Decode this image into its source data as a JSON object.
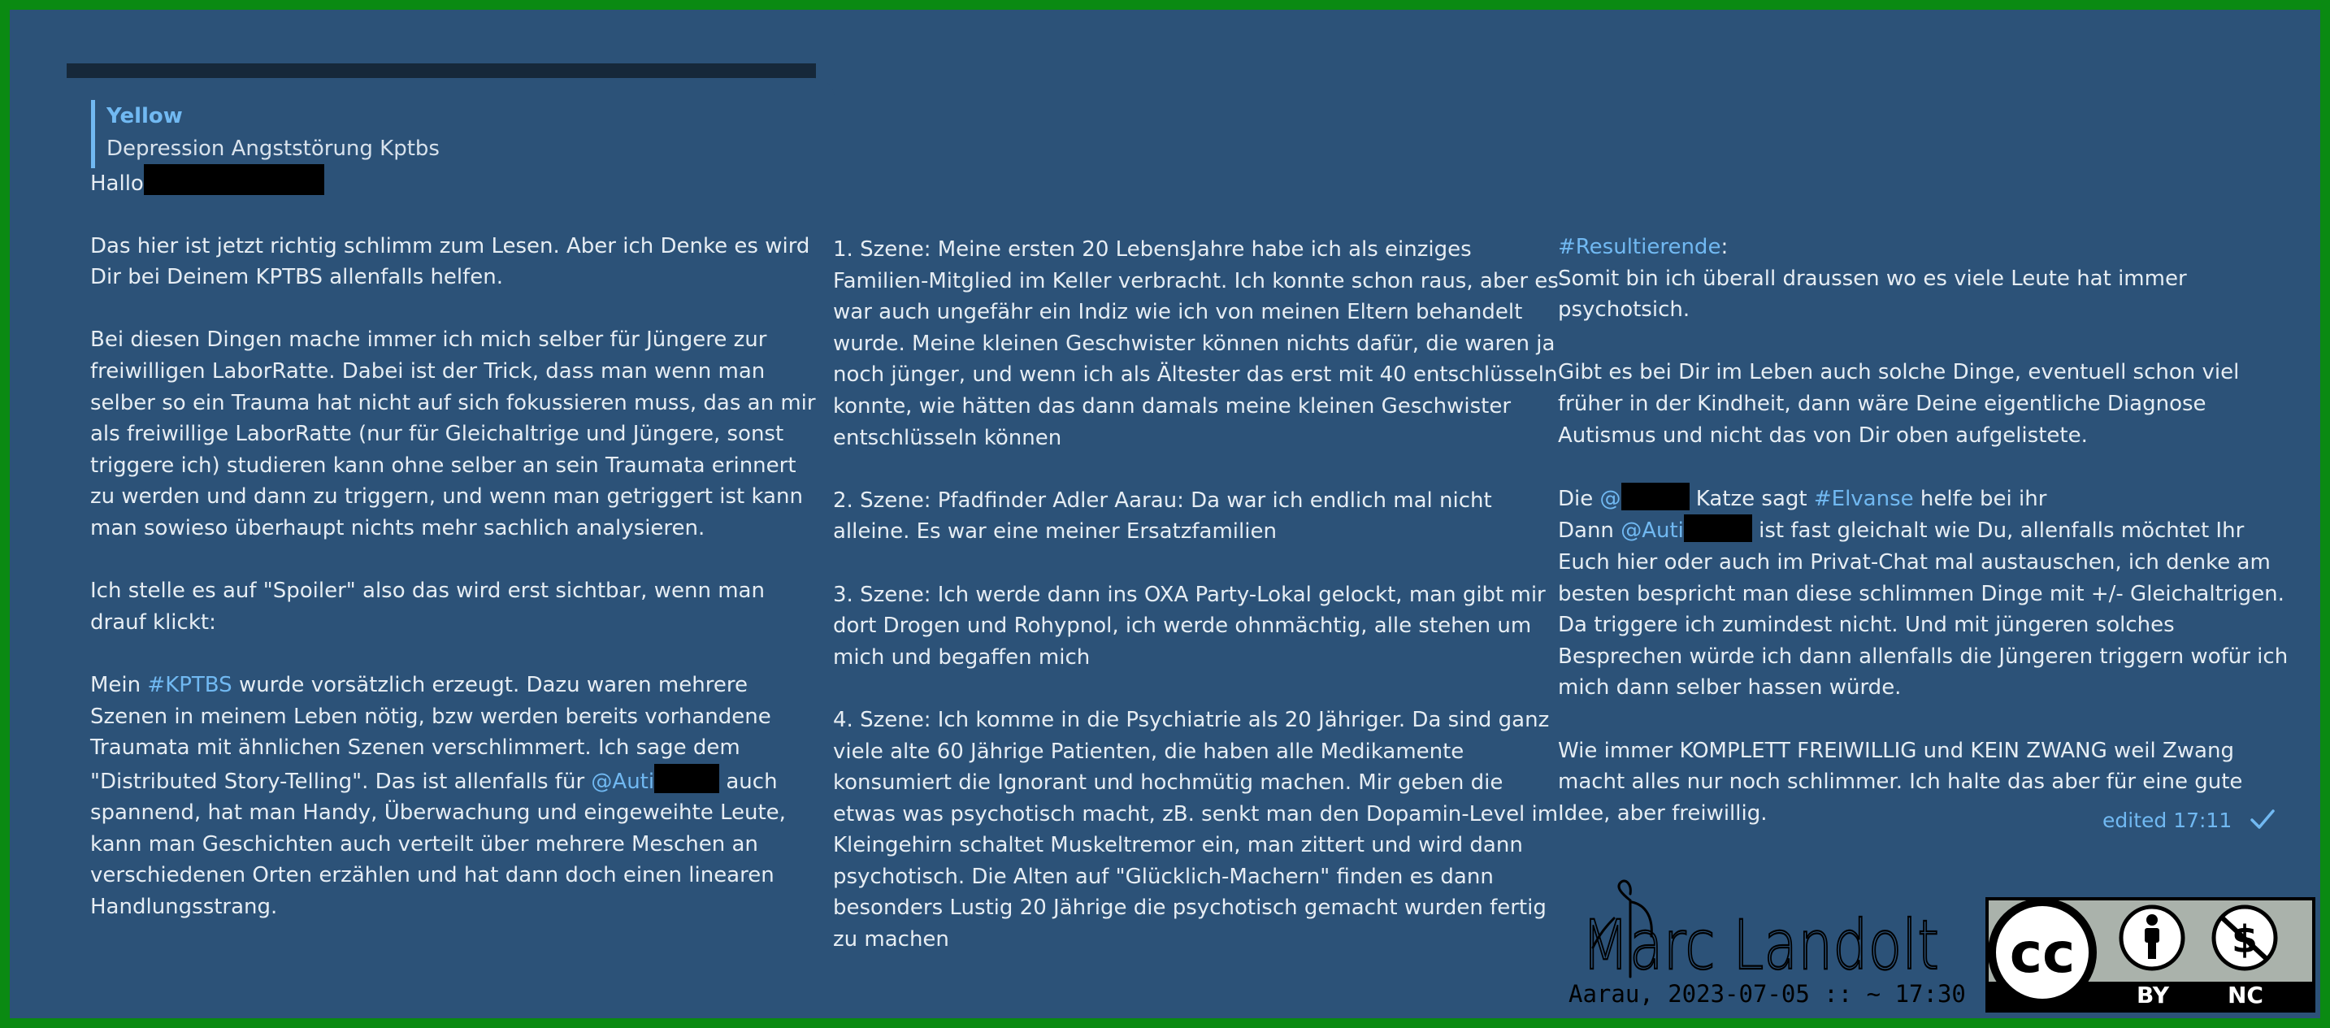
{
  "reply": {
    "name": "Yellow",
    "text": "Depression  Angststörung  Kptbs"
  },
  "message": {
    "greeting": "Hallo",
    "col1": {
      "p1": "Das hier ist jetzt richtig schlimm zum Lesen. Aber ich Denke es wird Dir bei Deinem KPTBS allenfalls helfen.",
      "p2": "Bei diesen Dingen mache immer ich mich selber für Jüngere zur freiwilligen LaborRatte. Dabei ist der Trick, dass man wenn man selber so ein Trauma hat nicht auf sich fokussieren muss, das an mir als freiwillige LaborRatte (nur für Gleichaltrige und Jüngere, sonst triggere ich) studieren kann ohne selber an sein Traumata erinnert zu werden und dann zu triggern, und wenn man getriggert ist kann man sowieso überhaupt nichts mehr sachlich analysieren.",
      "p3": "Ich stelle es auf \"Spoiler\" also das wird erst sichtbar, wenn man drauf klickt:",
      "p4a": "Mein ",
      "p4_tag": "#KPTBS",
      "p4b": " wurde vorsätzlich erzeugt. Dazu waren mehrere Szenen in meinem Leben nötig, bzw werden bereits vorhandene Traumata mit ähnlichen Szenen verschlimmert. Ich sage dem \"Distributed Story-Telling\". Das ist allenfalls für ",
      "p4_mention": "@Auti",
      "p4c": " auch spannend, hat man Handy, Überwachung und eingeweihte Leute, kann man Geschichten auch verteilt über mehrere Meschen an verschiedenen Orten erzählen und hat dann doch einen linearen Handlungsstrang."
    },
    "col2": {
      "p1": "1. Szene: Meine ersten 20 LebensJahre habe ich als einziges Familien-Mitglied im Keller verbracht. Ich konnte schon raus, aber es war auch ungefähr ein Indiz wie ich von meinen Eltern behandelt wurde. Meine kleinen Geschwister können nichts dafür, die waren ja noch jünger, und wenn ich als Ältester das erst mit 40 entschlüsseln konnte, wie hätten das dann damals meine kleinen Geschwister entschlüsseln können",
      "p2": "2. Szene: Pfadfinder Adler Aarau: Da war ich endlich mal nicht alleine. Es war eine meiner Ersatzfamilien",
      "p3": "3. Szene: Ich werde dann ins OXA Party-Lokal gelockt, man gibt mir dort Drogen und Rohypnol, ich werde ohnmächtig, alle stehen um mich und begaffen mich",
      "p4": "4. Szene: Ich komme in die Psychiatrie als 20 Jähriger. Da sind ganz viele alte 60 Jährige Patienten, die haben alle Medikamente konsumiert die Ignorant und hochmütig machen. Mir geben die etwas was psychotisch macht, zB. senkt man den Dopamin-Level im Kleingehirn schaltet Muskeltremor ein, man zittert und wird dann psychotisch. Die Alten auf \"Glücklich-Machern\" finden es dann besonders Lustig 20 Jährige die psychotisch gemacht wurden fertig zu machen"
    },
    "col3": {
      "p1_tag": "#Resultierende",
      "p1_colon": ":",
      "p1b": "Somit bin ich überall draussen wo es viele Leute hat immer psychotsich.",
      "p2": "Gibt es bei Dir im Leben auch solche Dinge, eventuell schon viel früher in der Kindheit, dann wäre Deine eigentliche Diagnose Autismus und nicht das von Dir oben aufgelistete.",
      "p3a": "Die ",
      "p3_mention1": "@",
      "p3b": " Katze sagt ",
      "p3_tag": "#Elvanse",
      "p3c": " helfe bei ihr",
      "p3d": "Dann ",
      "p3_mention2": "@Auti",
      "p3e": " ist fast gleichalt wie Du, allenfalls möchtet Ihr Euch hier oder auch im Privat-Chat mal austauschen, ich denke am besten bespricht man diese schlimmen Dinge mit +/- Gleichaltrigen. Da triggere ich zumindest nicht. Und mit jüngeren solches Besprechen würde ich dann allenfalls die Jüngeren triggern wofür ich mich dann selber hassen würde.",
      "p4": "Wie immer KOMPLETT FREIWILLIG und KEIN ZWANG weil Zwang macht alles nur noch schlimmer. Ich halte das aber für eine gute Idee, aber freiwillig."
    },
    "edited_label": "edited 17:11"
  },
  "signature": {
    "name": "Marc Landolt",
    "date_line": "Aarau, 2023-07-05 :: ~ 17:30"
  },
  "license": {
    "cc": "cc",
    "by": "BY",
    "nc": "NC"
  },
  "colors": {
    "background": "#2c5278",
    "border": "#0a8a12",
    "link": "#71b9f2",
    "text": "#e6edf3"
  },
  "icons": [
    "check-icon",
    "creative-commons-icon",
    "attribution-icon",
    "noncommercial-icon"
  ]
}
